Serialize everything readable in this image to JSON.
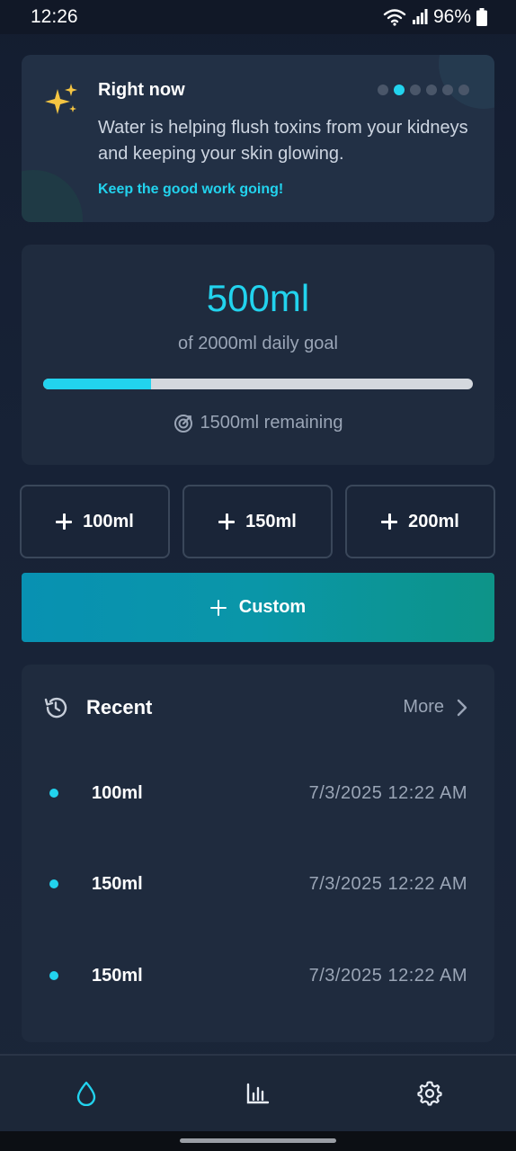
{
  "status_bar": {
    "time": "12:26",
    "battery": "96%"
  },
  "insight": {
    "title": "Right now",
    "text": "Water is helping flush toxins from your kidneys and keeping your skin glowing.",
    "cta": "Keep the good work going!",
    "dots_total": 6,
    "dots_active_index": 1,
    "icon": "sparkles-icon"
  },
  "progress": {
    "amount": "500ml",
    "goal_text": "of 2000ml daily goal",
    "fraction": 0.25,
    "remaining": "1500ml remaining",
    "icon": "target-icon"
  },
  "quick_add": [
    {
      "label": "100ml"
    },
    {
      "label": "150ml"
    },
    {
      "label": "200ml"
    }
  ],
  "custom": {
    "label": "Custom"
  },
  "recent": {
    "title": "Recent",
    "more_label": "More",
    "items": [
      {
        "amount": "100ml",
        "time": "7/3/2025 12:22 AM"
      },
      {
        "amount": "150ml",
        "time": "7/3/2025 12:22 AM"
      },
      {
        "amount": "150ml",
        "time": "7/3/2025 12:22 AM"
      }
    ]
  },
  "nav": {
    "items": [
      {
        "icon": "water-drop-icon",
        "active": true
      },
      {
        "icon": "bar-chart-icon",
        "active": false
      },
      {
        "icon": "gear-icon",
        "active": false
      }
    ]
  },
  "colors": {
    "accent": "#22d3ee",
    "background": "#131c2e",
    "card": "#1f2b3e",
    "muted_text": "#9aa5b6"
  }
}
